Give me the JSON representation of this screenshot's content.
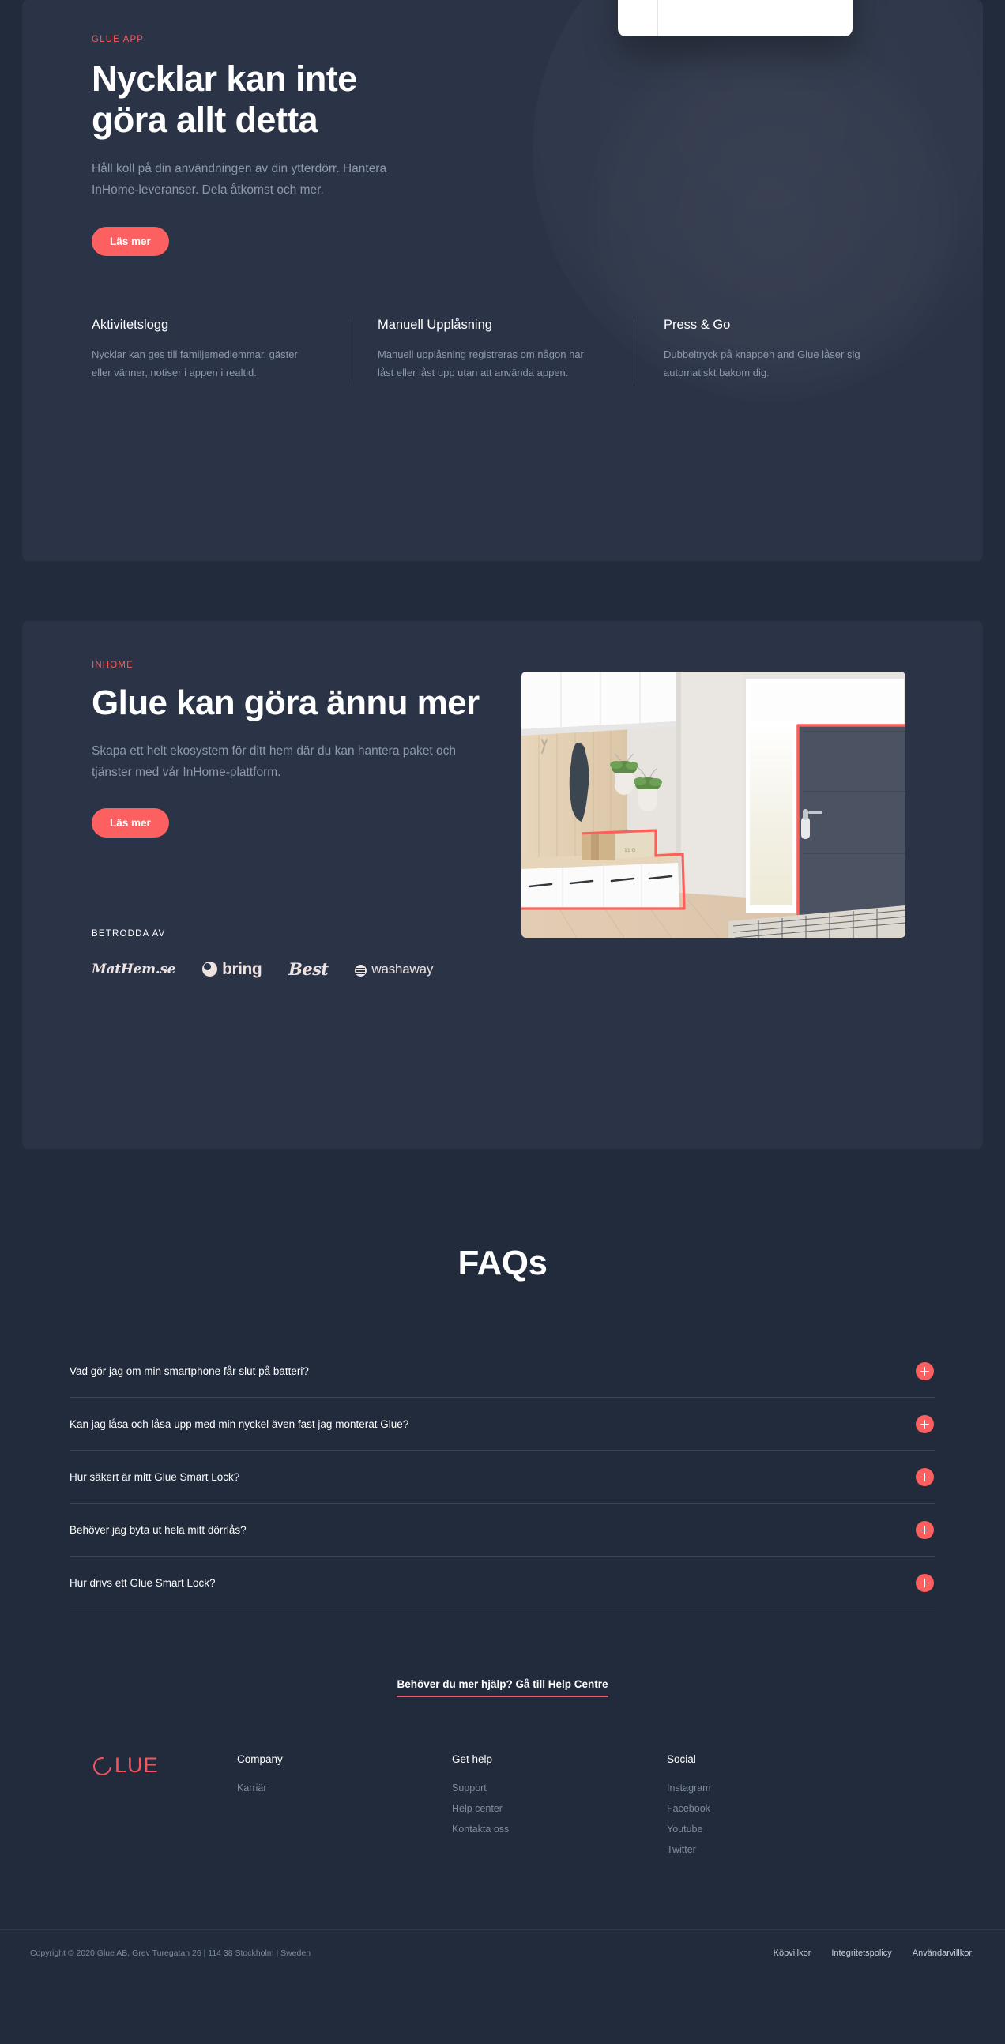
{
  "theme": {
    "page_bg": "#222b3c",
    "card_bg": "#2b3447",
    "accent": "#fc6060",
    "accent_link_underline": "#f4576a",
    "muted_text": "#8e99ac"
  },
  "app_section": {
    "eyebrow": "GLUE APP",
    "heading": "Nycklar kan inte göra allt detta",
    "body": "Håll koll på din användningen av din ytterdörr. Hantera InHome-leveranser. Dela åtkomst och mer.",
    "cta_label": "Läs mer",
    "features": [
      {
        "title": "Aktivitetslogg",
        "body": "Nycklar kan ges till familjemedlemmar, gäster eller vänner, notiser i appen i realtid."
      },
      {
        "title": "Manuell Upplåsning",
        "body": "Manuell upplåsning registreras om någon har låst eller låst upp utan att använda appen."
      },
      {
        "title": "Press & Go",
        "body": "Dubbeltryck på knappen and Glue låser sig automatiskt bakom dig."
      }
    ]
  },
  "inhome_section": {
    "eyebrow": "INHOME",
    "heading": "Glue kan göra ännu mer",
    "body": "Skapa ett helt ekosystem för ditt hem där du kan hantera paket och tjänster med vår InHome-plattform.",
    "cta_label": "Läs mer",
    "trusted_label": "BETRODDA AV",
    "logos": [
      {
        "name": "MatHem.se"
      },
      {
        "name": "bring"
      },
      {
        "name": "Best"
      },
      {
        "name": "washaway"
      }
    ]
  },
  "faq": {
    "title": "FAQs",
    "items": [
      {
        "question": "Vad gör jag om min smartphone får slut på batteri?"
      },
      {
        "question": "Kan jag låsa och låsa upp med min nyckel även fast jag monterat Glue?"
      },
      {
        "question": "Hur säkert är mitt Glue Smart Lock?"
      },
      {
        "question": "Behöver jag byta ut hela mitt dörrlås?"
      },
      {
        "question": "Hur drivs ett Glue Smart Lock?"
      }
    ],
    "help_link": "Behöver du mer hjälp? Gå till Help Centre"
  },
  "footer": {
    "brand": "GLUE",
    "columns": [
      {
        "title": "Company",
        "links": [
          "Karriär"
        ]
      },
      {
        "title": "Get help",
        "links": [
          "Support",
          "Help center",
          "Kontakta oss"
        ]
      },
      {
        "title": "Social",
        "links": [
          "Instagram",
          "Facebook",
          "Youtube",
          "Twitter"
        ]
      }
    ],
    "copyright": "Copyright © 2020 Glue AB, Grev Turegatan 26 | 114 38 Stockholm | Sweden",
    "legal_links": [
      "Köpvillkor",
      "Integritetspolicy",
      "Användarvillkor"
    ]
  }
}
